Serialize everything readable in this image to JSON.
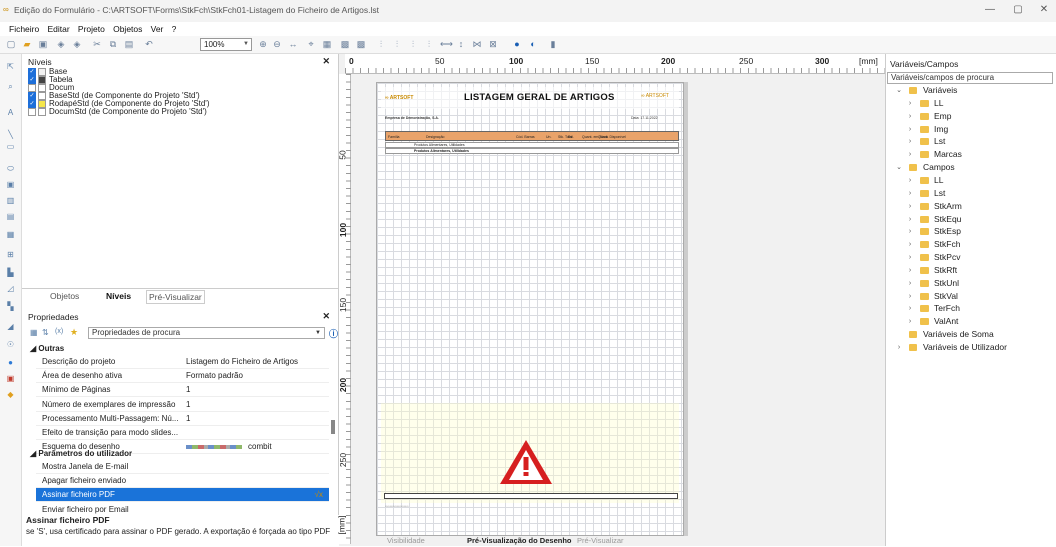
{
  "window": {
    "title": "Edição do Formulário - C:\\ARTSOFT\\Forms\\StkFch\\StkFch01-Listagem do Ficheiro de Artigos.lst",
    "min": "—",
    "max": "▢",
    "close": "✕"
  },
  "menu": [
    "Ficheiro",
    "Editar",
    "Projeto",
    "Objetos",
    "Ver",
    "?"
  ],
  "toolbar": {
    "zoom": "100%"
  },
  "levels": {
    "title": "Níveis",
    "items": [
      {
        "label": "Base",
        "checked": true,
        "color": "#f2f2f2"
      },
      {
        "label": "Tabela",
        "checked": true,
        "color": "#444444"
      },
      {
        "label": "Docum",
        "checked": false,
        "color": "#ffffff"
      },
      {
        "label": "BaseStd (de Componente do Projeto 'Std')",
        "checked": true,
        "color": "#ffffff"
      },
      {
        "label": "RodapéStd (de Componente do Projeto 'Std')",
        "checked": true,
        "color": "#f5e64a"
      },
      {
        "label": "DocumStd (de Componente do Projeto 'Std')",
        "checked": false,
        "color": "#ffffff"
      }
    ]
  },
  "lefttabs": [
    "Objetos",
    "Níveis",
    "Pré-Visualizar"
  ],
  "properties": {
    "title": "Propriedades",
    "search_placeholder": "Propriedades de procura",
    "section1": "Outras",
    "rows1": [
      {
        "k": "Descrição do projeto",
        "v": "Listagem do Ficheiro de Artigos"
      },
      {
        "k": "Área de desenho ativa",
        "v": "Formato padrão"
      },
      {
        "k": "Mínimo de Páginas",
        "v": "1"
      },
      {
        "k": "Número de exemplares de impressão",
        "v": "1"
      },
      {
        "k": "Processamento Multi-Passagem: Nú...",
        "v": "1"
      },
      {
        "k": "Efeito de transição para modo slides...",
        "v": ""
      },
      {
        "k": "Esquema do desenho",
        "v": "combit"
      }
    ],
    "section2": "Parâmetros do utilizador",
    "rows2": [
      {
        "k": "Mostra Janela de E-mail",
        "v": ""
      },
      {
        "k": "Apagar ficheiro enviado",
        "v": ""
      },
      {
        "k": "Assinar ficheiro PDF",
        "v": ""
      },
      {
        "k": "Enviar ficheiro por Email",
        "v": ""
      }
    ],
    "desc_title": "Assinar ficheiro PDF",
    "desc_text": "se 'S', usa certificado para assinar o PDF gerado. A exportação é forçada ao tipo PDF"
  },
  "ruler": {
    "h": [
      "0",
      "50",
      "100",
      "150",
      "200",
      "250",
      "300",
      "[mm]"
    ],
    "v": [
      "50",
      "100",
      "150",
      "200",
      "250",
      "[mm]"
    ]
  },
  "report": {
    "title": "LISTAGEM GERAL DE ARTIGOS",
    "logo": "ARTSOFT",
    "company": "Empresa de Demonstração, S.A.",
    "date": "Data: 17.11.2022",
    "cols": [
      "Família",
      "Designação",
      "Cód. Barras",
      "Un.",
      "Stk. Total",
      "Exi.",
      "Quant. em Stock",
      "Quant. Disponível"
    ],
    "row1": "Produtos Alimentares, Utilidades",
    "row2": "Produtos Alimentares, Utilidades"
  },
  "bottomtabs": [
    "Visibilidade",
    "Pré-Visualização do Desenho",
    "Pré-Visualizar"
  ],
  "variables": {
    "title": "Variáveis/Campos",
    "search_placeholder": "Variáveis/campos de procura",
    "tree": [
      {
        "label": "Variáveis",
        "level": 0,
        "open": true
      },
      {
        "label": "LL",
        "level": 1
      },
      {
        "label": "Emp",
        "level": 1
      },
      {
        "label": "Img",
        "level": 1
      },
      {
        "label": "Lst",
        "level": 1
      },
      {
        "label": "Marcas",
        "level": 1
      },
      {
        "label": "Campos",
        "level": 0,
        "open": true
      },
      {
        "label": "LL",
        "level": 1
      },
      {
        "label": "Lst",
        "level": 1
      },
      {
        "label": "StkArm",
        "level": 1
      },
      {
        "label": "StkEqu",
        "level": 1
      },
      {
        "label": "StkEsp",
        "level": 1
      },
      {
        "label": "StkFch",
        "level": 1
      },
      {
        "label": "StkPcv",
        "level": 1
      },
      {
        "label": "StkRft",
        "level": 1
      },
      {
        "label": "StkUnl",
        "level": 1
      },
      {
        "label": "StkVal",
        "level": 1
      },
      {
        "label": "TerFch",
        "level": 1
      },
      {
        "label": "ValAnt",
        "level": 1
      },
      {
        "label": "Variáveis de Soma",
        "level": 0
      },
      {
        "label": "Variáveis de Utilizador",
        "level": 0
      }
    ]
  }
}
